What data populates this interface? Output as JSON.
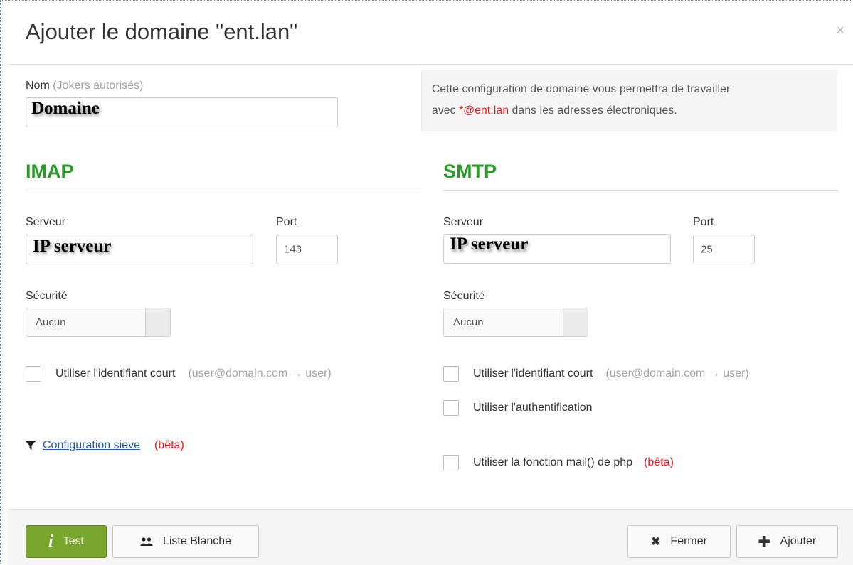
{
  "dialog": {
    "title": "Ajouter le domaine \"ent.lan\"",
    "close_glyph": "×"
  },
  "name_field": {
    "label": "Nom",
    "hint": "(Jokers autorisés)",
    "overlay": "Domaine"
  },
  "info": {
    "line1": "Cette configuration de domaine vous permettra de travailler",
    "prefix": "avec ",
    "highlight": "*@ent.lan",
    "suffix": " dans les adresses électroniques."
  },
  "imap": {
    "title": "IMAP",
    "server_label": "Serveur",
    "server_overlay": "IP serveur",
    "port_label": "Port",
    "port_value": "143",
    "security_label": "Sécurité",
    "security_value": "Aucun",
    "short_id_label": "Utiliser l'identifiant court",
    "short_id_hint": "(user@domain.com → user)",
    "sieve_icon": "filter-icon",
    "sieve_link": "Configuration sieve",
    "sieve_beta": "(bêta)"
  },
  "smtp": {
    "title": "SMTP",
    "server_label": "Serveur",
    "server_overlay": "IP serveur",
    "port_label": "Port",
    "port_value": "25",
    "security_label": "Sécurité",
    "security_value": "Aucun",
    "short_id_label": "Utiliser l'identifiant court",
    "short_id_hint": "(user@domain.com → user)",
    "auth_label": "Utiliser l'authentification",
    "mail_label": "Utiliser la fonction mail() de php",
    "mail_beta": "(bêta)"
  },
  "footer": {
    "test_label": "Test",
    "whitelist_label": "Liste Blanche",
    "close_label": "Fermer",
    "add_label": "Ajouter"
  },
  "colors": {
    "section_green": "#2a9b2a",
    "button_green": "#78a52b",
    "beta_red": "#e01b1b",
    "link_blue": "#1f5fa8"
  }
}
